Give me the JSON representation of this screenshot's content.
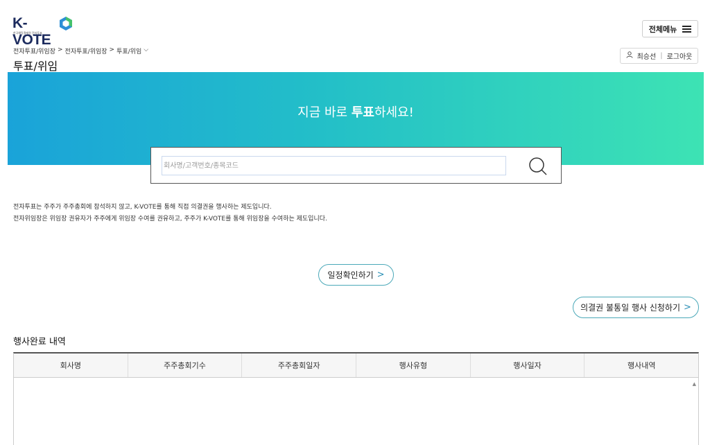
{
  "header": {
    "logo_text": "K-VOTE",
    "logo_sub": "한국예탁결제원 전자투표",
    "menu_label": "전체메뉴",
    "breadcrumb": [
      "전자투표/위임장",
      "전자투표/위임장",
      "투표/위임"
    ],
    "page_title": "투표/위임",
    "user_name": "최승선",
    "logout_label": "로그아웃"
  },
  "hero": {
    "title_pre": "지금 바로 ",
    "title_bold": "투표",
    "title_post": "하세요!",
    "search_placeholder": "회사명/고객번호/종목코드"
  },
  "description": {
    "line1": "전자투표는 주주가 주주총회에 참석하지 않고, K-VOTE를 통해 직접 의결권을 행사하는 제도입니다.",
    "line2": "전자위임장은 위임장 권유자가 주주에게 위임장 수여를 권유하고, 주주가 K-VOTE를 통해 위임장을 수여하는 제도입니다."
  },
  "buttons": {
    "schedule": "일정확인하기",
    "apply": "의결권 불통일 행사 신청하기"
  },
  "history": {
    "title": "행사완료 내역",
    "columns": [
      "회사명",
      "주주총회기수",
      "주주총회일자",
      "행사유형",
      "행사일자",
      "행사내역"
    ]
  },
  "colors": {
    "brand_navy": "#1c2b5e",
    "hero_start": "#1aa3d9",
    "hero_end": "#3de3b4",
    "accent": "#2a8fb5"
  }
}
